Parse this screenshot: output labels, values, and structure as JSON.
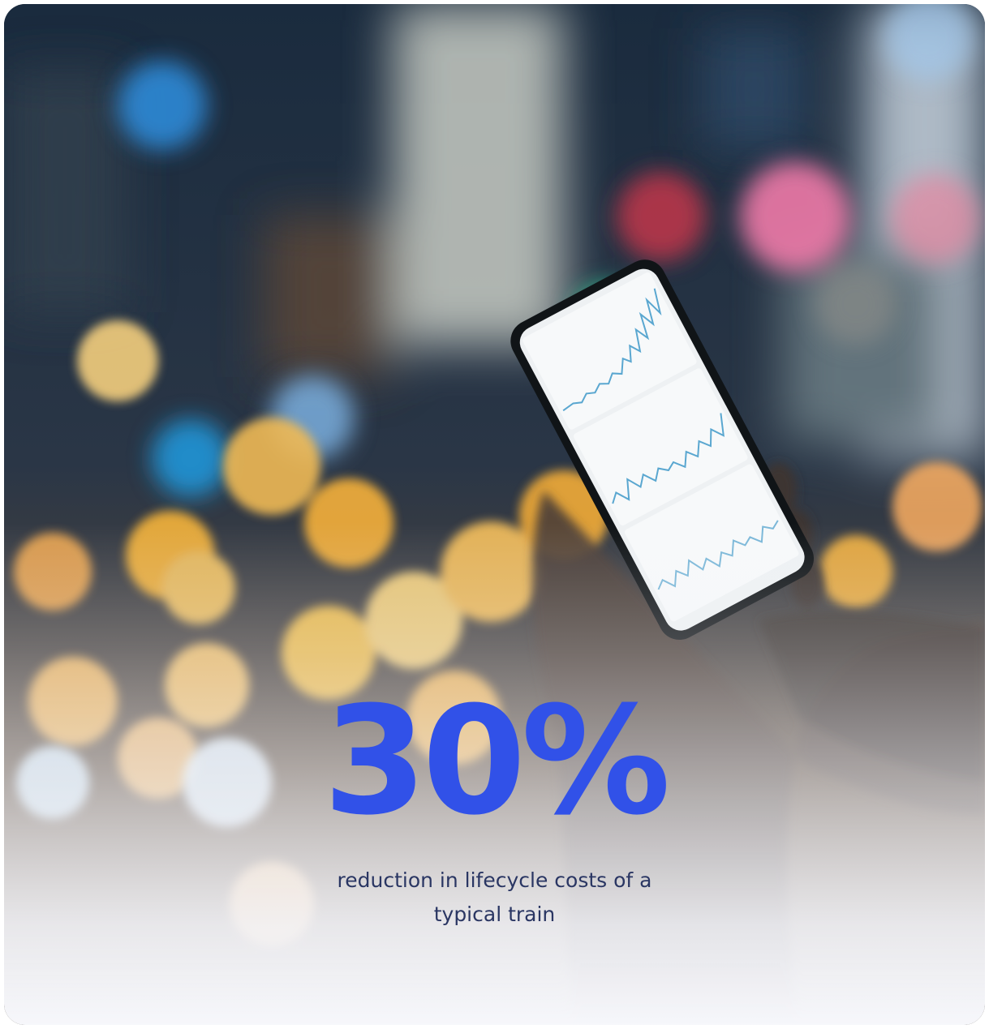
{
  "stat": {
    "value": "30%",
    "caption": "reduction in lifecycle costs of a typical train"
  },
  "colors": {
    "accent": "#3151e8",
    "caption": "#2a3663",
    "fade": "#f6f7fb"
  },
  "image": {
    "subject": "hand-holding-phone-with-line-charts-over-bokeh-city-lights"
  }
}
